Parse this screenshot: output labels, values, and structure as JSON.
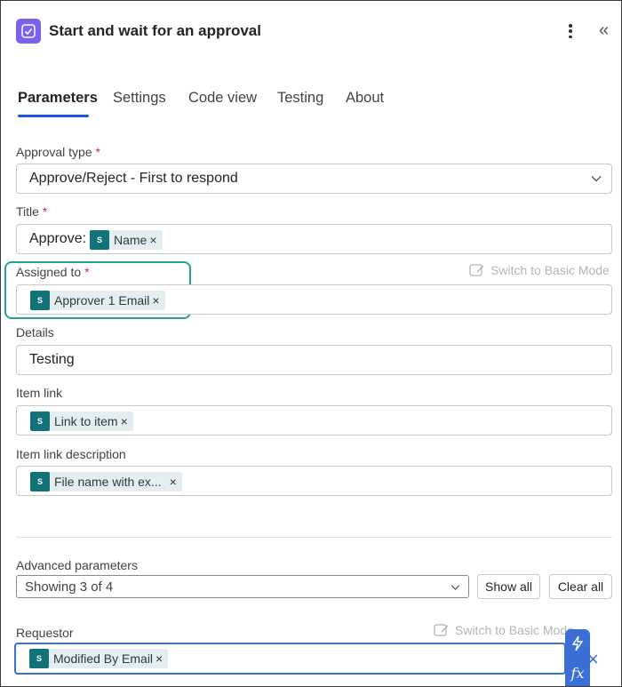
{
  "header": {
    "title": "Start and wait for an approval",
    "more_icon": "more-vertical-icon",
    "collapse_icon": "double-chevron-left-icon"
  },
  "tabs": [
    {
      "label": "Parameters",
      "active": true
    },
    {
      "label": "Settings"
    },
    {
      "label": "Code view"
    },
    {
      "label": "Testing"
    },
    {
      "label": "About"
    }
  ],
  "fields": {
    "approval_type": {
      "label": "Approval type",
      "required": "*",
      "value": "Approve/Reject - First to respond"
    },
    "title": {
      "label": "Title",
      "required": "*",
      "prefix": "Approve:",
      "token": "Name"
    },
    "assigned_to": {
      "label": "Assigned to",
      "required": "*",
      "token": "Approver 1 Email",
      "switch_label": "Switch to Basic Mode"
    },
    "details": {
      "label": "Details",
      "value": "Testing"
    },
    "item_link": {
      "label": "Item link",
      "token": "Link to item"
    },
    "item_link_description": {
      "label": "Item link description",
      "token": "File name with ex..."
    }
  },
  "token_icon_text": "S",
  "token_remove": "×",
  "advanced": {
    "label": "Advanced parameters",
    "select_value": "Showing 3 of 4",
    "show_all": "Show all",
    "clear_all": "Clear all"
  },
  "requestor": {
    "label": "Requestor",
    "token": "Modified By Email",
    "switch_label": "Switch to Basic Mode",
    "dynamic_content_icon": "lightning-icon",
    "expression_icon": "fx",
    "clear_icon": "×"
  },
  "colors": {
    "accent": "#1a56db",
    "token_icon": "#11727a",
    "highlight": "#25a18e",
    "app_icon": "#7b61f0"
  }
}
